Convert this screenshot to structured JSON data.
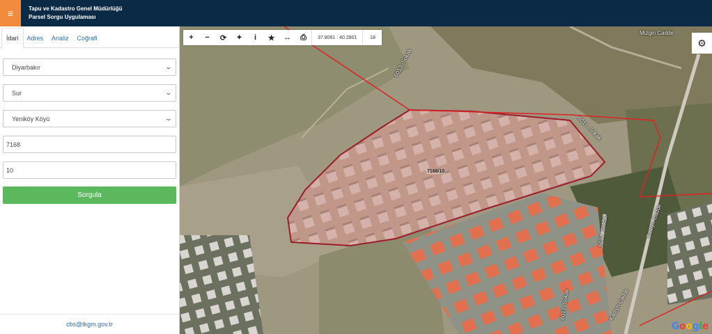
{
  "header": {
    "menu_icon": "hamburger-icon",
    "title_line1": "Tapu ve Kadastro Genel Müdürlüğü",
    "title_line2": "Parsel Sorgu Uygulaması",
    "accent": "#f38b3c",
    "bg": "#0b2a45"
  },
  "sidebar": {
    "tabs": [
      {
        "label": "İdari",
        "active": true
      },
      {
        "label": "Adres"
      },
      {
        "label": "Analiz"
      },
      {
        "label": "Coğrafi"
      }
    ],
    "province": "Diyarbakır",
    "district": "Sur",
    "neighborhood": "Yeniköy Köyü",
    "block": "7168",
    "parcel": "10",
    "submit_label": "Sorgula",
    "footer_email": "cbs@tkgm.gov.tr"
  },
  "map": {
    "coords": "37.8091 : 40.2801",
    "zoom": "18",
    "parcel_label": "7168/10",
    "streets": [
      "Mizgin Cadde",
      "6013. Sokak",
      "6017. Sokak",
      "6017. Sokak",
      "Kadıyn Cadde",
      "6017. Sokak",
      "Kadıyn Cadde"
    ],
    "attribution": "Google",
    "parcel_color": "#9b1c2c"
  }
}
